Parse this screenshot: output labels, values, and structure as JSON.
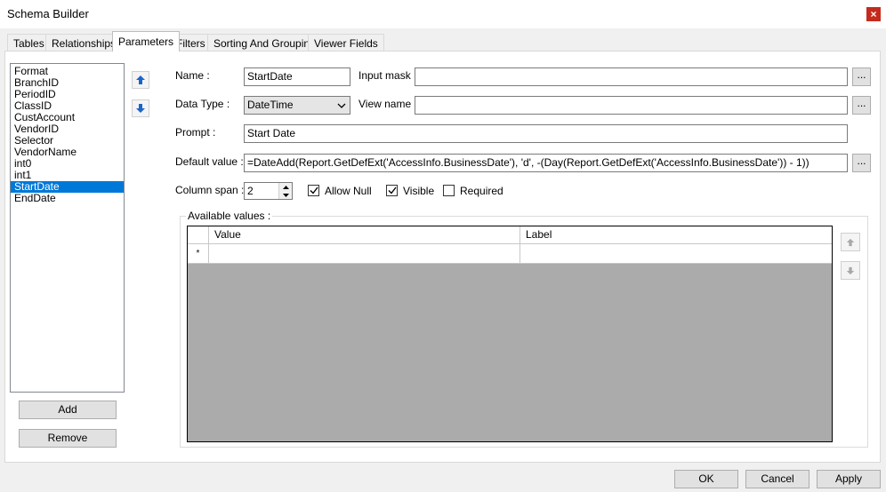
{
  "window": {
    "title": "Schema Builder",
    "close_glyph": "×"
  },
  "tabs": [
    {
      "label": "Tables"
    },
    {
      "label": "Relationships"
    },
    {
      "label": "Parameters"
    },
    {
      "label": "Filters"
    },
    {
      "label": "Sorting And Grouping"
    },
    {
      "label": "Viewer Fields"
    }
  ],
  "active_tab": "Parameters",
  "parameters": {
    "items": [
      "Format",
      "BranchID",
      "PeriodID",
      "ClassID",
      "CustAccount",
      "VendorID",
      "Selector",
      "VendorName",
      "int0",
      "int1",
      "StartDate",
      "EndDate"
    ],
    "selected": "StartDate",
    "add_label": "Add",
    "remove_label": "Remove"
  },
  "form": {
    "name_label": "Name :",
    "name_value": "StartDate",
    "input_mask_label": "Input mask :",
    "input_mask_value": "",
    "data_type_label": "Data Type :",
    "data_type_value": "DateTime",
    "view_name_label": "View name :",
    "view_name_value": "",
    "prompt_label": "Prompt :",
    "prompt_value": "Start Date",
    "default_value_label": "Default value :",
    "default_value": "=DateAdd(Report.GetDefExt('AccessInfo.BusinessDate'), 'd', -(Day(Report.GetDefExt('AccessInfo.BusinessDate')) - 1))",
    "column_span_label": "Column span :",
    "column_span_value": "2",
    "ellipsis": "...",
    "allow_null_label": "Allow Null",
    "allow_null": true,
    "visible_label": "Visible",
    "visible": true,
    "required_label": "Required",
    "required": false
  },
  "available_values": {
    "title": "Available values :",
    "columns": [
      "Value",
      "Label"
    ],
    "new_row_marker": "*"
  },
  "footer": {
    "ok_label": "OK",
    "cancel_label": "Cancel",
    "apply_label": "Apply"
  },
  "colors": {
    "selection": "#0078d7",
    "arrow_blue": "#1c64c8",
    "grid_bg": "#ababab"
  }
}
